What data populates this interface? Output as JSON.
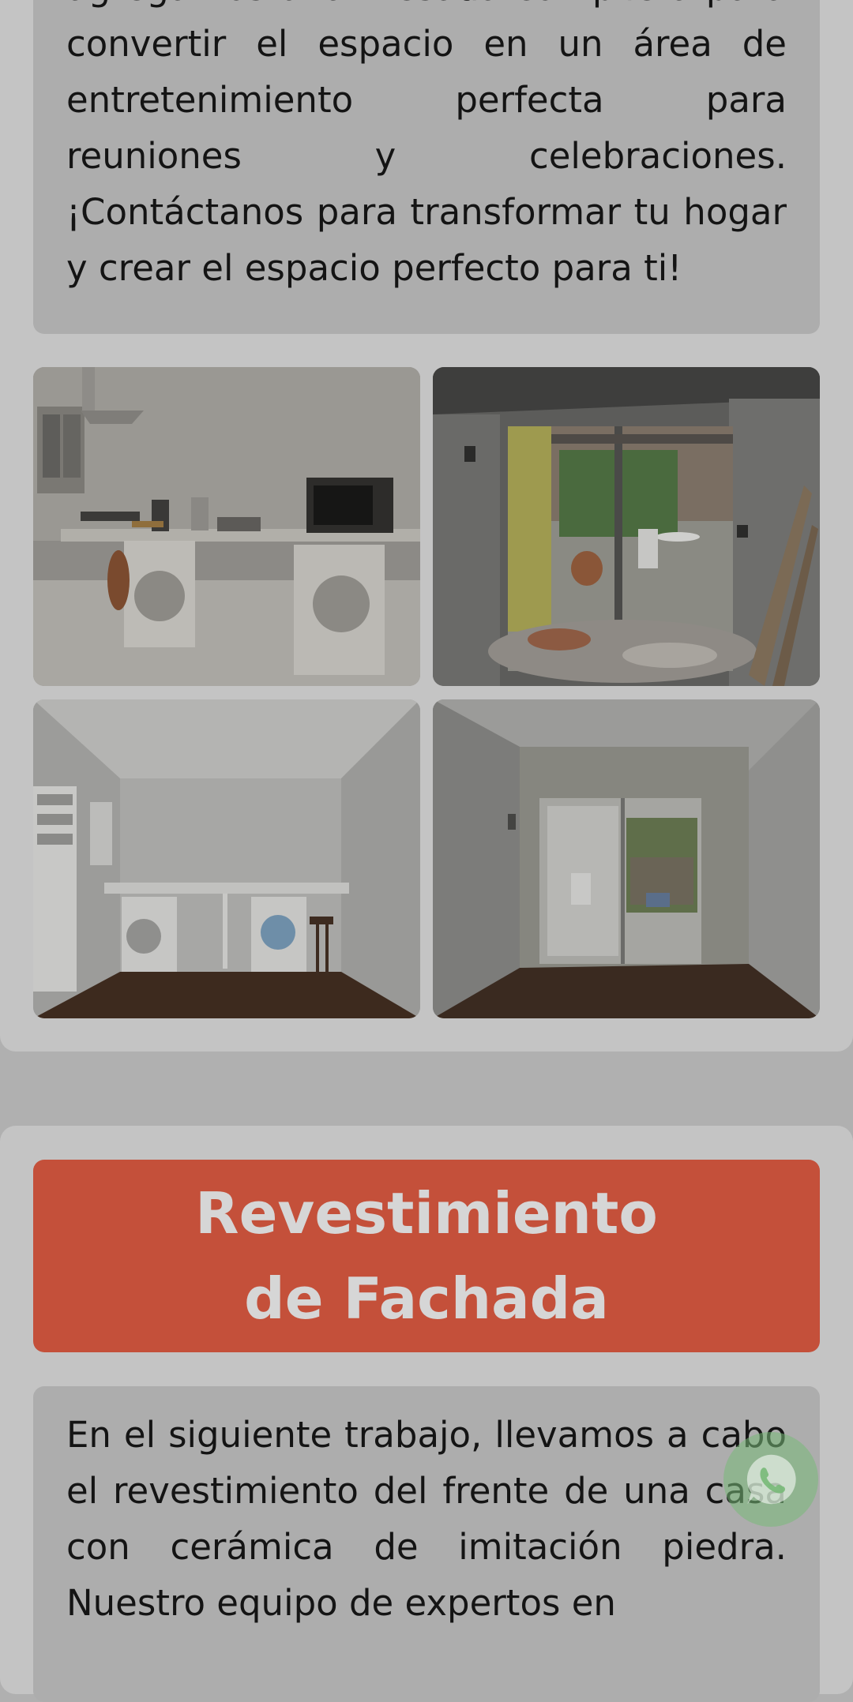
{
  "section1": {
    "text_tail": "agregamos una mesada con pileta para convertir el espacio en un área de entretenimiento perfecta para reuniones y celebraciones. ¡Contáctanos para transformar tu hogar y crear el espacio perfecto para ti!",
    "photos": [
      {
        "icon": "kitchen-render-photo"
      },
      {
        "icon": "demolition-wall-opening-photo"
      },
      {
        "icon": "finished-laundry-room-photo"
      },
      {
        "icon": "finished-room-sliding-door-photo"
      }
    ]
  },
  "section2": {
    "title": "Revestimiento de Fachada",
    "text": "En el siguiente trabajo, llevamos a cabo el revestimiento del frente de una casa con cerámica de imitación piedra. Nuestro equipo de expertos en"
  },
  "whatsapp": {
    "icon": "whatsapp-icon"
  },
  "colors": {
    "accent": "#c4503a",
    "card": "#c4c4c4",
    "text_box": "#adadad",
    "overlay_bg": "#b0b0b0"
  }
}
